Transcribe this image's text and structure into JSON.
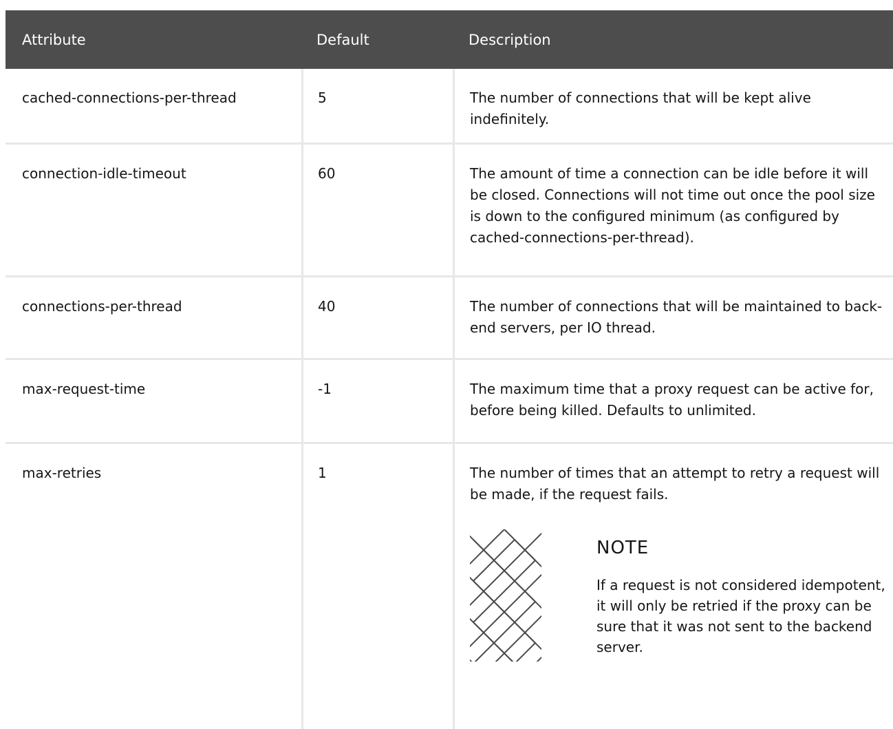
{
  "headers": {
    "attribute": "Attribute",
    "default": "Default",
    "description": "Description"
  },
  "rows": [
    {
      "attribute": "cached-connections-per-thread",
      "default": "5",
      "description": "The number of connections that will be kept alive indefinitely."
    },
    {
      "attribute": "connection-idle-timeout",
      "default": "60",
      "description": "The amount of time a connection can be idle before it will be closed. Connections will not time out once the pool size is down to the configured minimum (as configured by cached-connections-per-thread)."
    },
    {
      "attribute": "connections-per-thread",
      "default": "40",
      "description": "The number of connections that will be maintained to back-end servers, per IO thread."
    },
    {
      "attribute": "max-request-time",
      "default": "-1",
      "description": "The maximum time that a proxy request can be active for, before being killed. Defaults to unlimited."
    },
    {
      "attribute": "max-retries",
      "default": "1",
      "description": "The number of times that an attempt to retry a request will be made, if the request fails."
    }
  ],
  "note": {
    "title": "NOTE",
    "text": "If a request is not considered idempotent, it will only be retried if the proxy can be sure that it was not sent to the backend server.",
    "icon": "note-pattern-icon"
  },
  "colors": {
    "header_bg": "#4d4d4d",
    "header_text": "#ffffff",
    "border": "#e7e7e7",
    "text": "#151515"
  }
}
